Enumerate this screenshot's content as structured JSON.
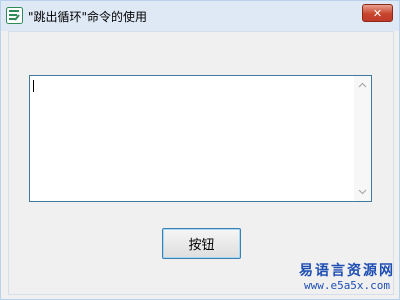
{
  "window": {
    "title": "\"跳出循环\"命令的使用",
    "close_glyph": "✕",
    "icon": "easy-language-app-icon"
  },
  "editbox": {
    "value": ""
  },
  "button": {
    "label": "按钮"
  },
  "watermark": {
    "line1": "易语言资源网",
    "line2": "www.e5a5x.com"
  },
  "colors": {
    "titlebar": "#dfe9f5",
    "client": "#f0f0f0",
    "close_button": "#c8452c",
    "edit_border": "#3f7b9c",
    "button_border": "#3c7fb1",
    "watermark": "#1f4fb3"
  }
}
